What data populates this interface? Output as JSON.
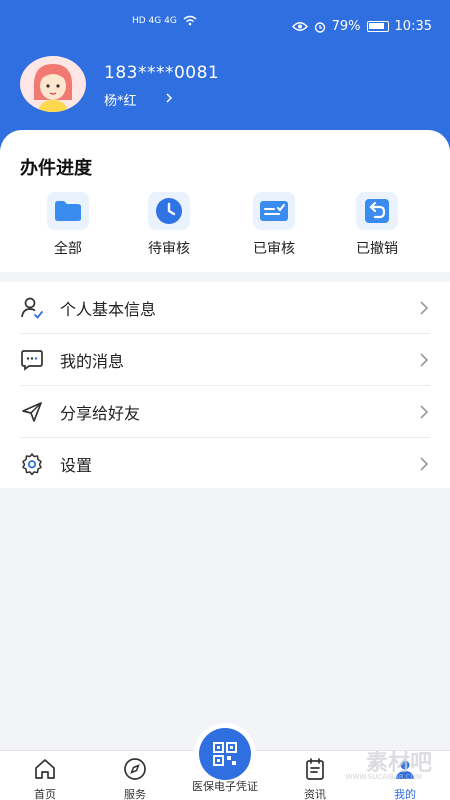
{
  "status_bar": {
    "left_text": "HD 4G 4G",
    "battery": "79%",
    "time": "10:35"
  },
  "user": {
    "phone": "183****0081",
    "name": "杨*红"
  },
  "progress": {
    "title": "办件进度",
    "items": [
      {
        "label": "全部",
        "icon": "folder-icon"
      },
      {
        "label": "待审核",
        "icon": "clock-icon"
      },
      {
        "label": "已审核",
        "icon": "checklist-icon"
      },
      {
        "label": "已撤销",
        "icon": "undo-icon"
      }
    ]
  },
  "menu": {
    "items": [
      {
        "label": "个人基本信息",
        "icon": "user-check-icon"
      },
      {
        "label": "我的消息",
        "icon": "message-icon"
      },
      {
        "label": "分享给好友",
        "icon": "send-icon"
      },
      {
        "label": "设置",
        "icon": "gear-icon"
      }
    ]
  },
  "bottom_nav": {
    "items": [
      {
        "label": "首页",
        "icon": "home-icon"
      },
      {
        "label": "服务",
        "icon": "compass-icon"
      },
      {
        "label": "医保电子凭证",
        "icon": "qr-icon"
      },
      {
        "label": "资讯",
        "icon": "news-icon"
      },
      {
        "label": "我的",
        "icon": "person-icon",
        "active": true
      }
    ],
    "active_color": "#2f6fe0"
  },
  "watermark": {
    "main": "素材吧",
    "sub": "WWW.SUCAIBAR.COM"
  },
  "colors": {
    "primary": "#2f6fe0",
    "icon_bg": "#eaf2fd",
    "avatar_bg": "#fde6e3"
  }
}
